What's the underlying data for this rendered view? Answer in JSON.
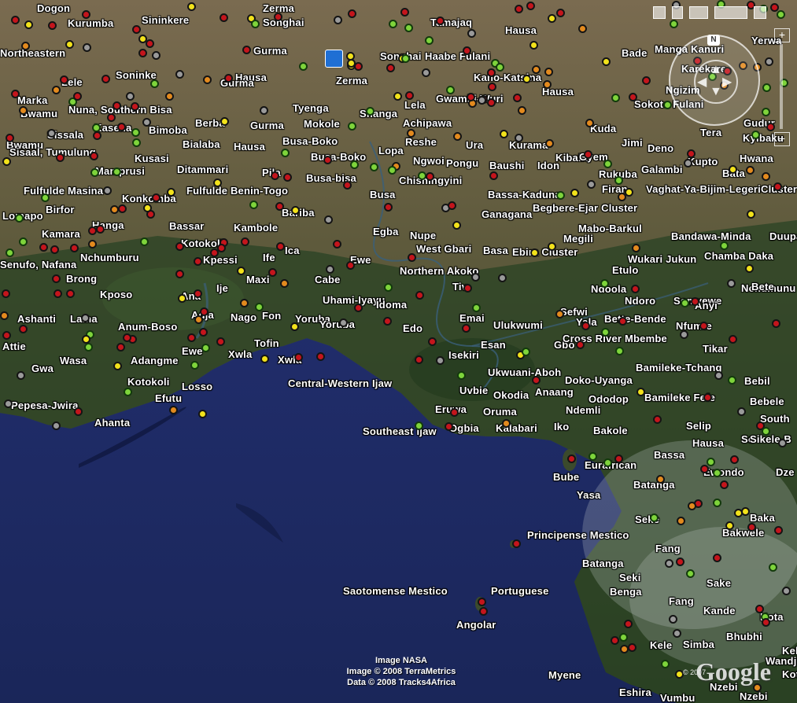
{
  "map": {
    "colors": {
      "ocean": "#1b2a5e",
      "land_dark": "#3b4a2c",
      "land_light": "#8c7c58",
      "label": "#ffffff",
      "marker_red": "#c4151c",
      "marker_green": "#7ed43b"
    },
    "labels": [
      "Dogon",
      "Kurumba",
      "Sininkere",
      "Songhai",
      "Zerma",
      "Tamajaq",
      "Hausa",
      "Northeastern",
      "Gurma",
      "Hausa",
      "Songhai",
      "Haabe Fulani",
      "Soninke",
      "Zerma",
      "Kano-Katsina",
      "Bade",
      "Manga Kanuri",
      "Yerwa",
      "Lele",
      "Gurma",
      "Lela",
      "Gwamhi-Wuri",
      "Hausa",
      "Karekare",
      "Ngizim",
      "Marka",
      "Nuna, Southern Bisa",
      "Tyenga",
      "Shanga",
      "Sokoto Fulani",
      "Bwamu",
      "Achipawa",
      "Mokole",
      "Kasena",
      "Bimoba",
      "Berba",
      "Gurma",
      "Sissala",
      "Busa-Boko",
      "Kuda",
      "Gudur",
      "Bwamu",
      "Bialaba",
      "Hausa",
      "Reshe",
      "Ura",
      "Kurama",
      "Jimi",
      "Deno",
      "Tera",
      "Kyibaku",
      "Sisaal, Tumulung",
      "Busa-Boko",
      "Lopa",
      "Kiballo",
      "Gyem",
      "Kupto",
      "Hwana",
      "Mamprusi",
      "Kusasi",
      "Ditammari",
      "Pila",
      "Ngwoi",
      "Pongu",
      "Baushi",
      "Idon",
      "Rukuba",
      "Galambi",
      "Bata",
      "Busa-bisa",
      "Chishingyini",
      "Fulfulde Masina",
      "Fulfulde Benin-Togo",
      "Busa",
      "Bassa-Kaduna",
      "Firan",
      "Vaghat-Ya-Bijim-Legeri",
      "Cluster",
      "Konkomba",
      "Bariba",
      "Ganagana",
      "Begbere-Ejar Cluster",
      "Birfor",
      "Lomapo",
      "Hanga",
      "Kamara",
      "Bassar",
      "Kambole",
      "Egba",
      "Nupe",
      "Mabo-Barkul",
      "Bandawa-Minda",
      "Duupa",
      "Kotokoli",
      "Ica",
      "West Gbari",
      "Basa",
      "Ebira Cluster",
      "Megili",
      "Nchumburu",
      "Kpessi",
      "Ife",
      "Ewe",
      "Wukari Jukun",
      "Chamba Daka",
      "Senufo, Nafana",
      "Brong",
      "Maxi",
      "Cabe",
      "Northern Akoko",
      "Etulo",
      "Nchumunu",
      "Kposo",
      "Ana",
      "Ije",
      "Uhami-Iyayu",
      "Tiv",
      "Ndoola",
      "Bete",
      "Ndoro",
      "Somyewe",
      "Anyi",
      "Ashanti",
      "Lama",
      "Adja",
      "Nago",
      "Fon",
      "Yoruba",
      "Yoruba",
      "Idoma",
      "Sefwi",
      "Anum-Boso",
      "Emai",
      "Ulukwumi",
      "Yala",
      "Bette-Bende",
      "Nfumte",
      "Attie",
      "Tofin",
      "Edo",
      "Gbo",
      "Cross River Mbembe",
      "Tikar",
      "Gwa",
      "Wasa",
      "Adangme",
      "Ewe",
      "Xwla",
      "Xwla",
      "Esan",
      "Isekiri",
      "Bamileke-Tchang",
      "Kotokoli",
      "Losso",
      "Ukwuani-Aboh",
      "Doko-Uyanga",
      "Bebil",
      "Central-Western Ijaw",
      "Uvbie",
      "Okodia",
      "Anaang",
      "Bamileke Fefe",
      "Pepesa-Jwira",
      "Efutu",
      "Ododop",
      "Bebele",
      "Eruwa",
      "Oruma",
      "Ndemli",
      "South",
      "Ahanta",
      "Ogbia",
      "Kalabari",
      "Iko",
      "Bakole",
      "Selip",
      "Southeast Ijaw",
      "Hausa",
      "So",
      "Sikele-B",
      "Bassa",
      "Eurafrican",
      "Bube",
      "Ewondo",
      "Dze",
      "Batanga",
      "Yasa",
      "Seke",
      "Baka",
      "Principense Mestico",
      "Bakwele",
      "Fang",
      "Batanga",
      "Seki",
      "Sake",
      "Saotomense Mestico",
      "Portuguese",
      "Benga",
      "Fang",
      "Kande",
      "Angolar",
      "Kota",
      "Bhubhi",
      "Kele",
      "Simba",
      "Wandji",
      "Myene",
      "Eshira",
      "Vumbu",
      "Nzebi",
      "Nzebi",
      "Kele",
      "Kota"
    ],
    "credits": [
      "Image NASA",
      "Image © 2008 TerraMetrics",
      "Data © 2008 Tracks4Africa"
    ],
    "logo": "Google",
    "copyright_small": "© 2007"
  }
}
